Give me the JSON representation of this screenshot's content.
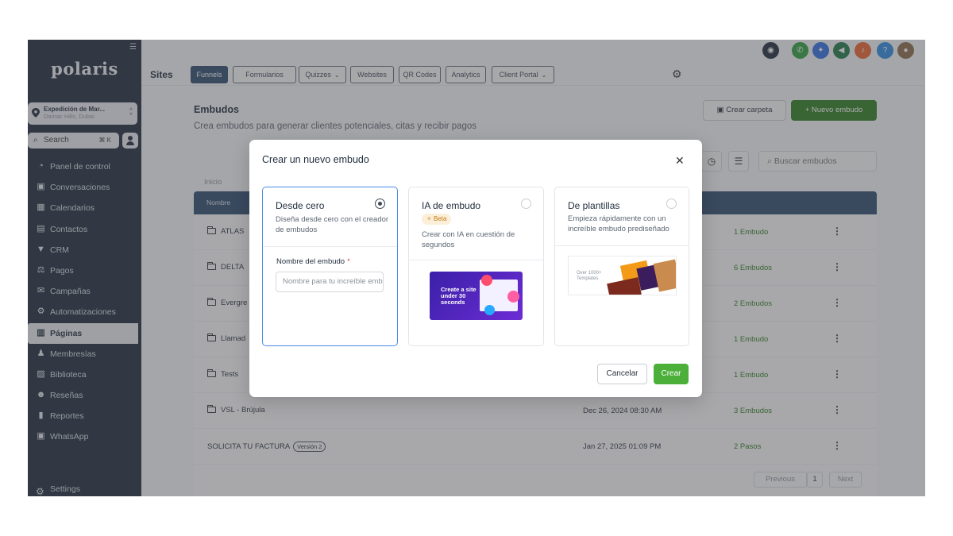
{
  "sidebar": {
    "logo": "polaris",
    "location": {
      "name": "Expedición de Mar...",
      "sub": "Damac Hills, Dubai"
    },
    "search": {
      "label": "Search",
      "shortcut": "⌘ K"
    },
    "items": [
      {
        "label": "Panel de control",
        "icon": "dashboard-icon",
        "glyph": "◔"
      },
      {
        "label": "Conversaciones",
        "icon": "chat-icon",
        "glyph": "▣"
      },
      {
        "label": "Calendarios",
        "icon": "calendar-icon",
        "glyph": "▦"
      },
      {
        "label": "Contactos",
        "icon": "contacts-icon",
        "glyph": "▤"
      },
      {
        "label": "CRM",
        "icon": "funnel-icon",
        "glyph": "▼"
      },
      {
        "label": "Pagos",
        "icon": "payments-icon",
        "glyph": "⚖"
      },
      {
        "label": "Campañas",
        "icon": "campaigns-icon",
        "glyph": "✉"
      },
      {
        "label": "Automatizaciones",
        "icon": "automation-icon",
        "glyph": "⚙"
      },
      {
        "label": "Páginas",
        "icon": "pages-icon",
        "glyph": "▥",
        "active": true
      },
      {
        "label": "Membresías",
        "icon": "membership-icon",
        "glyph": "♟"
      },
      {
        "label": "Biblioteca",
        "icon": "media-library-icon",
        "glyph": "▨"
      },
      {
        "label": "Reseñas",
        "icon": "reviews-icon",
        "glyph": "☻"
      },
      {
        "label": "Reportes",
        "icon": "reports-icon",
        "glyph": "▮"
      },
      {
        "label": "WhatsApp",
        "icon": "whatsapp-icon",
        "glyph": "▣"
      }
    ],
    "settings": "Settings"
  },
  "header": {
    "section": "Sites",
    "tabs": [
      {
        "label": "Funnels",
        "active": true
      },
      {
        "label": "Formularios"
      },
      {
        "label": "Quizzes",
        "dropdown": true
      },
      {
        "label": "Websites"
      },
      {
        "label": "QR Codes"
      },
      {
        "label": "Analytics"
      },
      {
        "label": "Client Portal",
        "dropdown": true
      }
    ],
    "top_icons": [
      {
        "name": "support-chat-icon",
        "color": "#1f2d3d",
        "glyph": "◉"
      },
      {
        "name": "phone-icon",
        "color": "#2e9e3f",
        "glyph": "✆"
      },
      {
        "name": "magic-icon",
        "color": "#2f6fe0",
        "glyph": "✦"
      },
      {
        "name": "announcement-icon",
        "color": "#1f7a4a",
        "glyph": "◀"
      },
      {
        "name": "notifications-icon",
        "color": "#e9652e",
        "glyph": "♪"
      },
      {
        "name": "help-icon",
        "color": "#2f8ae0",
        "glyph": "?"
      },
      {
        "name": "user-avatar-icon",
        "color": "#8a6a4a",
        "glyph": "●"
      }
    ]
  },
  "page": {
    "title": "Embudos",
    "subtitle": "Crea embudos para generar clientes potenciales, citas y recibir pagos",
    "create_folder": "Crear carpeta",
    "new_funnel": "+  Nuevo embudo",
    "search_placeholder": "Buscar embudos",
    "breadcrumb": "Inicio",
    "table_header": "Nombre",
    "rows": [
      {
        "name": "ATLAS",
        "folder": true,
        "date": "",
        "count": "1 Embudo"
      },
      {
        "name": "DELTA",
        "folder": true,
        "date": "",
        "count": "6 Embudos"
      },
      {
        "name": "Evergre",
        "folder": true,
        "date": "",
        "count": "2 Embudos"
      },
      {
        "name": "Llamad",
        "folder": true,
        "date": "",
        "count": "1 Embudo"
      },
      {
        "name": "Tests",
        "folder": true,
        "date": "",
        "count": "1 Embudo"
      },
      {
        "name": "VSL - Brújula",
        "folder": true,
        "date": "Dec 26, 2024 08:30 AM",
        "count": "3 Embudos"
      },
      {
        "name": "SOLICITA TU FACTURA",
        "folder": false,
        "badge": "Versión 2",
        "date": "Jan 27, 2025 01:09 PM",
        "count": "2 Pasos"
      }
    ],
    "pagination": {
      "previous": "Previous",
      "page": "1",
      "next": "Next"
    }
  },
  "modal": {
    "title": "Crear un nuevo embudo",
    "options": [
      {
        "title": "Desde cero",
        "desc": "Diseña desde cero con el creador de embudos",
        "selected": true
      },
      {
        "title": "IA de embudo",
        "badge": "Beta",
        "desc": "Crear con IA en cuestión de segundos",
        "selected": false
      },
      {
        "title": "De plantillas",
        "desc": "Empieza rápidamente con un increíble embudo prediseñado",
        "selected": false
      }
    ],
    "field_label": "Nombre del embudo",
    "field_required": "*",
    "field_placeholder": "Nombre para tu increíble embudo",
    "promo_text": "Create a site under 30 seconds",
    "template_text": "Over 1000+ Templates",
    "cancel": "Cancelar",
    "create": "Crear"
  }
}
